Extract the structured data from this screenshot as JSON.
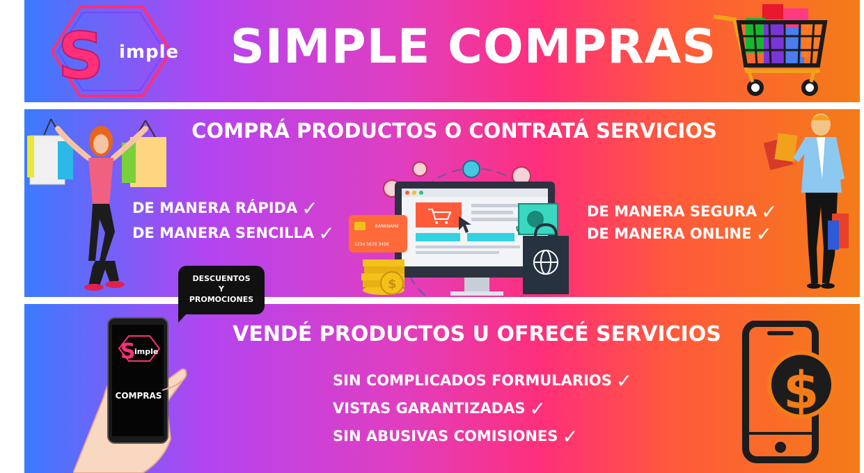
{
  "header": {
    "title": "SIMPLE COMPRAS",
    "logo_text": "imple"
  },
  "buy_section": {
    "title": "COMPRÁ PRODUCTOS O CONTRATÁ SERVICIOS",
    "features_left": [
      "DE MANERA RÁPIDA",
      "DE MANERA SENCILLA"
    ],
    "features_right": [
      "DE MANERA SEGURA",
      "DE MANERA ONLINE"
    ],
    "card_brand": "BANKNAME",
    "card_number": "1234 5678 3456"
  },
  "sell_section": {
    "title": "VENDÉ PRODUCTOS U OFRECÉ SERVICIOS",
    "features": [
      "SIN COMPLICADOS FORMULARIOS",
      "VISTAS GARANTIZADAS",
      "SIN ABUSIVAS COMISIONES"
    ],
    "bubble_lines": [
      "DESCUENTOS",
      "Y",
      "PROMOCIONES"
    ],
    "phone_label": "COMPRAS",
    "phone_logo_text": "imple"
  },
  "icons": {
    "check": "✓",
    "dollar": "$"
  },
  "colors": {
    "gradient_start": "#3b7bff",
    "gradient_mid": "#e03ec0",
    "gradient_end": "#f47c18",
    "text": "#ffffff",
    "screen_accent": "#ff5a3a"
  }
}
